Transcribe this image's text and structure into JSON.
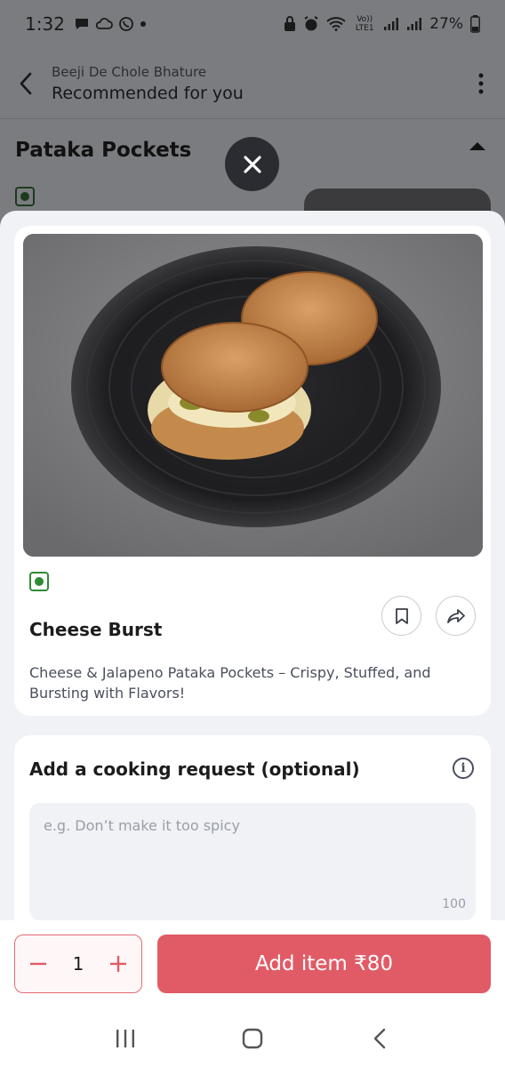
{
  "status_bar": {
    "time": "1:32",
    "battery": "27%",
    "network_label": "Vo)) LTE1"
  },
  "header": {
    "restaurant": "Beeji De Chole Bhature",
    "title": "Recommended for you"
  },
  "section": {
    "title": "Pataka Pockets"
  },
  "item": {
    "name": "Cheese Burst",
    "description": "Cheese & Jalapeno Pataka Pockets – Crispy, Stuffed, and Bursting with Flavors!"
  },
  "cooking_request": {
    "title": "Add a cooking request (optional)",
    "placeholder": "e.g. Don’t make it too spicy",
    "char_limit": "100"
  },
  "cart": {
    "quantity": "1",
    "add_label": "Add item ₹80"
  },
  "colors": {
    "accent": "#e15b66",
    "veg": "#2f8a34"
  }
}
